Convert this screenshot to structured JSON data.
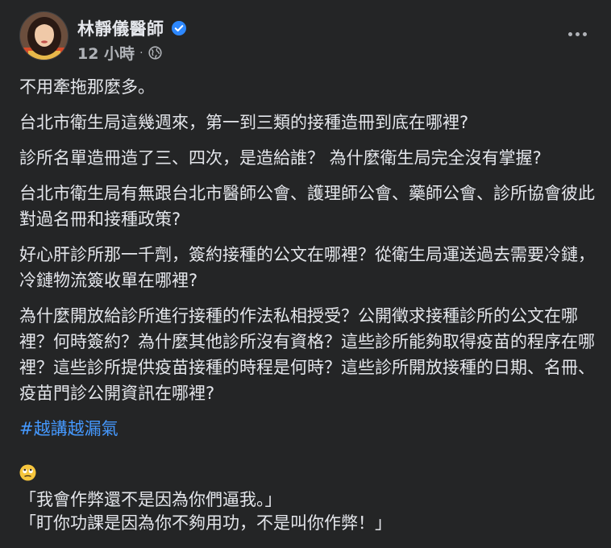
{
  "post": {
    "author": "林靜儀醫師",
    "time": "12 小時",
    "separator": "·",
    "paragraphs": [
      "不用牽拖那麼多。",
      "台北市衛生局這幾週來，第一到三類的接種造冊到底在哪裡?",
      "診所名單造冊造了三、四次，是造給誰？ 為什麼衛生局完全沒有掌握?",
      "台北市衛生局有無跟台北市醫師公會、護理師公會、藥師公會、診所協會彼此對過名冊和接種政策?",
      "好心肝診所那一千劑，簽約接種的公文在哪裡？從衛生局運送過去需要冷鏈，冷鏈物流簽收單在哪裡?",
      "為什麼開放給診所進行接種的作法私相授受？公開徵求接種診所的公文在哪裡？何時簽約？為什麼其他診所沒有資格？這些診所能夠取得疫苗的程序在哪裡？這些診所提供疫苗接種的時程是何時？這些診所開放接種的日期、名冊、疫苗門診公開資訊在哪裡?"
    ],
    "hashtag": "#越講越漏氣",
    "emoji_icon": "rolling-eyes-emoji",
    "quotes": [
      "「我會作弊還不是因為你們逼我。」",
      "「盯你功課是因為你不夠用功，不是叫你作弊！」"
    ]
  },
  "colors": {
    "background": "#242526",
    "text": "#e4e6eb",
    "secondary": "#b0b3b8",
    "link": "#4599ff",
    "verified": "#2d88ff"
  }
}
